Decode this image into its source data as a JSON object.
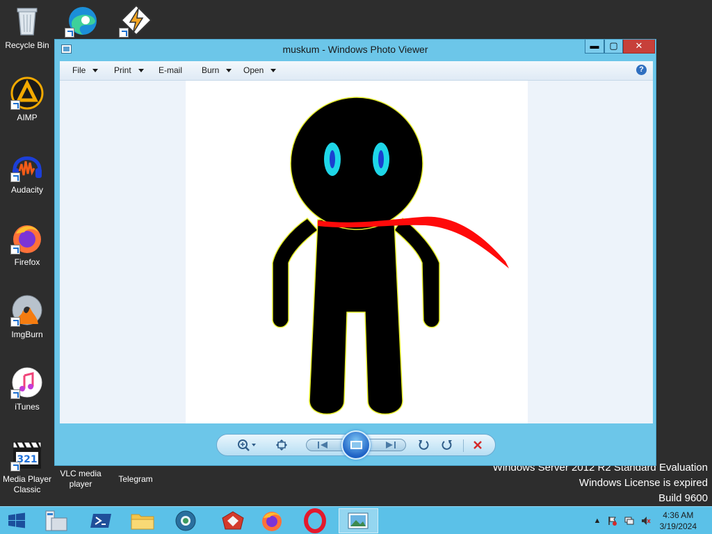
{
  "desktop": {
    "icons": [
      {
        "label": "Recycle Bin"
      },
      {
        "label": ""
      },
      {
        "label": ""
      },
      {
        "label": "AIMP"
      },
      {
        "label": "Audacity"
      },
      {
        "label": "Firefox"
      },
      {
        "label": "ImgBurn"
      },
      {
        "label": "iTunes"
      },
      {
        "label": "Media Player Classic"
      },
      {
        "label": "VLC media player"
      },
      {
        "label": "Telegram"
      }
    ],
    "watermark": {
      "line1": "Windows Server 2012 R2 Standard Evaluation",
      "line2": "Windows License is expired",
      "line3": "Build 9600"
    }
  },
  "window": {
    "title": "muskum - Windows Photo Viewer",
    "controls": {
      "minimize": "▬",
      "maximize": "▢",
      "close": "✕"
    },
    "menu": [
      {
        "label": "File",
        "has_dropdown": true
      },
      {
        "label": "Print",
        "has_dropdown": true
      },
      {
        "label": "E-mail",
        "has_dropdown": false
      },
      {
        "label": "Burn",
        "has_dropdown": true
      },
      {
        "label": "Open",
        "has_dropdown": true
      }
    ],
    "help": "?",
    "colors": {
      "scarf": "#ff0a0a",
      "eyes_outer": "#1ed6e8",
      "eyes_inner": "#1a3fd0",
      "outline": "#e6ef2a"
    }
  },
  "taskbar": {
    "clock_time": "4:36 AM",
    "clock_date": "3/19/2024",
    "tray_arrow": "▲"
  }
}
